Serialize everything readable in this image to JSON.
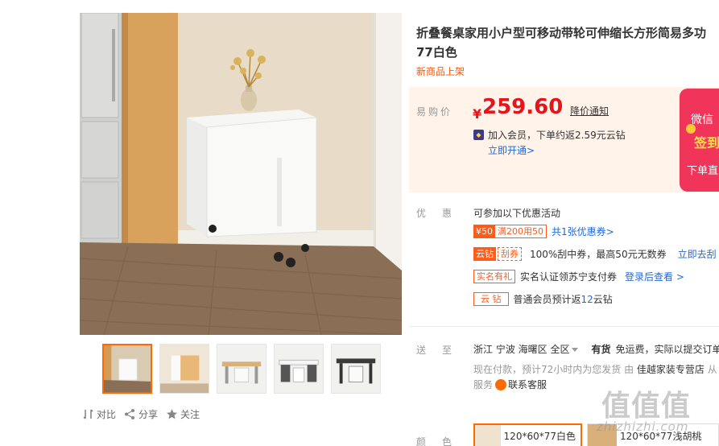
{
  "product": {
    "title": "折叠餐桌家用小户型可移动带轮可伸缩长方形简易多功",
    "title_line2": "77白色",
    "subtitle": "新商品上架"
  },
  "price": {
    "label": "易购价",
    "currency": "¥",
    "value": "259.60",
    "notice": "降价通知",
    "member_text": "加入会员，下单约返2.59元云钻",
    "member_link": "立即开通>",
    "promo_card": {
      "line1": "微信",
      "line2": "签到",
      "line3": "下单直"
    }
  },
  "promotions": {
    "label": "优惠",
    "head": "可参加以下优惠活动",
    "coupon_amount": "¥50",
    "coupon_cond": "满200用50",
    "coupon_link": "共1张优惠券>",
    "yunzuan_tag": "云钻",
    "guaquan_tag": "刮券",
    "guaquan_text": "100%刮中券，最高50元无数券",
    "guaquan_link": "立即去刮",
    "realname_tag": "实名有礼",
    "realname_text": "实名认证领苏宁支付券",
    "realname_link": "登录后查看 >",
    "yunzuan2_tag": "云 钻",
    "yunzuan2_text_a": "普通会员预计返",
    "yunzuan2_num": "12",
    "yunzuan2_text_b": "云钻"
  },
  "delivery": {
    "label": "送至",
    "area": "浙江 宁波 海曙区 全区",
    "stock": "有货",
    "freight": "免运费，实际以提交订单",
    "sub_text": "现在付款，预计72小时内为您发货   由",
    "store": "佳越家装专营店",
    "store_tail": "从",
    "service_label": "服务",
    "service_link": "联系客服"
  },
  "colors": {
    "label": "颜色",
    "options": [
      "120*60*77白色",
      "120*60*77浅胡桃"
    ]
  },
  "actions": {
    "compare": "对比",
    "share": "分享",
    "follow": "关注"
  },
  "watermark": {
    "glyphs": "值值值",
    "url": "zhizhizhi.com"
  }
}
